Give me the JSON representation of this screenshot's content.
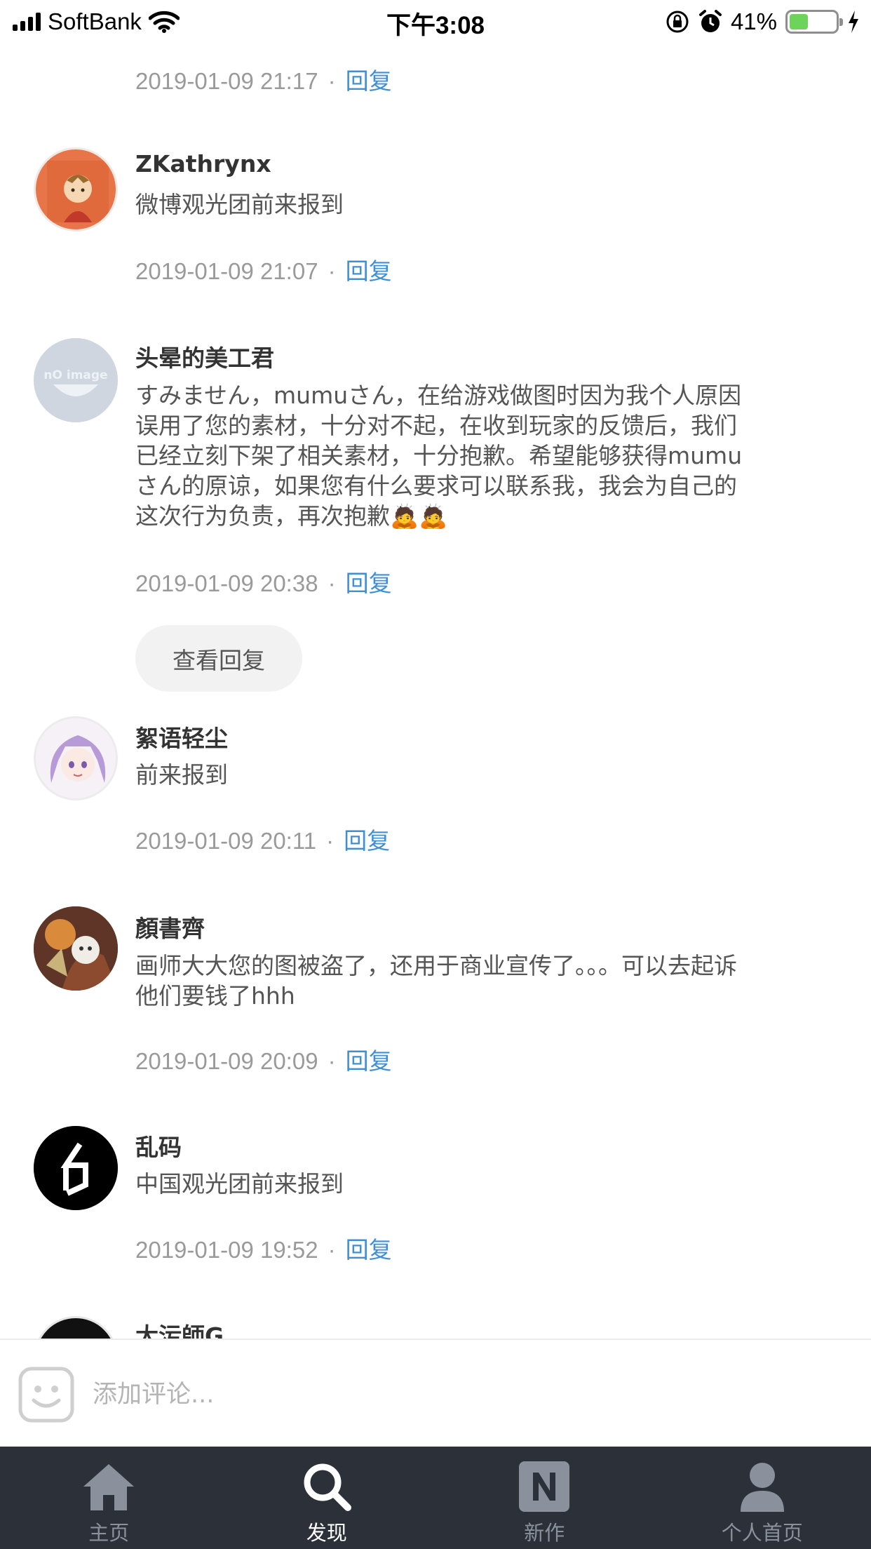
{
  "status_bar": {
    "carrier": "SoftBank",
    "time": "下午3:08",
    "battery_percent": "41%",
    "battery_level": 0.41,
    "icons": [
      "signal-icon",
      "wifi-icon",
      "rotation-lock-icon",
      "alarm-icon",
      "battery-icon",
      "charging-icon"
    ]
  },
  "comments": [
    {
      "date": "2019-01-09 21:17",
      "reply_label": "回复"
    },
    {
      "username": "ZKathrynx",
      "text": "微博观光团前来报到",
      "date": "2019-01-09 21:07",
      "reply_label": "回复"
    },
    {
      "username": "头晕的美工君",
      "text": "すみません，mumuさん，在给游戏做图时因为我个人原因误用了您的素材，十分对不起，在收到玩家的反馈后，我们已经立刻下架了相关素材，十分抱歉。希望能够获得mumuさん的原谅，如果您有什么要求可以联系我，我会为自己的这次行为负责，再次抱歉🙇🙇",
      "avatar_text": "nO image",
      "date": "2019-01-09 20:38",
      "reply_label": "回复",
      "view_replies_label": "查看回复"
    },
    {
      "username": "絮语轻尘",
      "text": "前来报到",
      "date": "2019-01-09 20:11",
      "reply_label": "回复"
    },
    {
      "username": "顏書齊",
      "text": "画师大大您的图被盗了，还用于商业宣传了。。。可以去起诉他们要钱了hhh",
      "date": "2019-01-09 20:09",
      "reply_label": "回复"
    },
    {
      "username": "乱码",
      "text": "中国观光团前来报到",
      "date": "2019-01-09 19:52",
      "reply_label": "回复"
    },
    {
      "username": "大污師G"
    }
  ],
  "comment_input": {
    "placeholder": "添加评论..."
  },
  "tab_bar": {
    "tabs": [
      {
        "label": "主页",
        "icon": "home-icon"
      },
      {
        "label": "发现",
        "icon": "search-icon",
        "active": true
      },
      {
        "label": "新作",
        "icon": "new-works-icon"
      },
      {
        "label": "个人首页",
        "icon": "profile-icon"
      }
    ]
  },
  "colors": {
    "reply_link": "#3f8fd6",
    "tab_bar_bg": "#2c3038",
    "battery_fill": "#6ed35a"
  }
}
